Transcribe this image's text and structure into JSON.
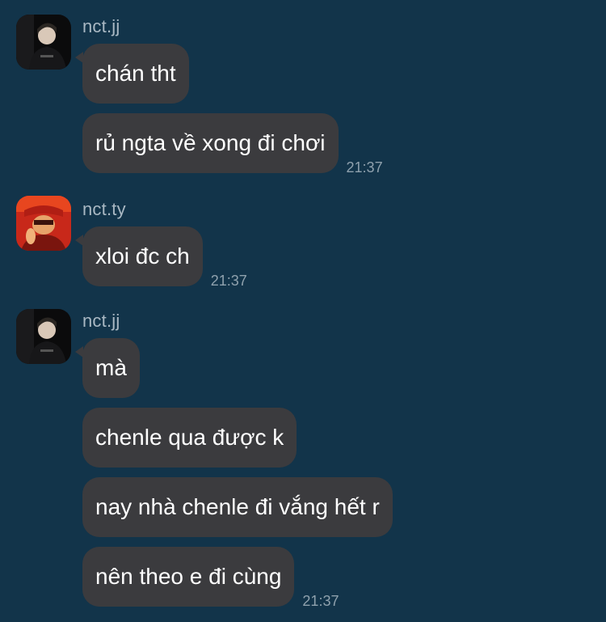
{
  "conversation": {
    "groups": [
      {
        "sender": "nct.jj",
        "avatar_icon": "profile-photo-dark",
        "messages": [
          {
            "text": "chán tht",
            "time": ""
          },
          {
            "text": "rủ ngta về xong đi chơi",
            "time": "21:37"
          }
        ]
      },
      {
        "sender": "nct.ty",
        "avatar_icon": "profile-photo-red",
        "messages": [
          {
            "text": "xloi đc ch",
            "time": "21:37"
          }
        ]
      },
      {
        "sender": "nct.jj",
        "avatar_icon": "profile-photo-dark",
        "messages": [
          {
            "text": "mà",
            "time": ""
          },
          {
            "text": "chenle qua được k",
            "time": ""
          },
          {
            "text": "nay nhà chenle đi vắng hết r",
            "time": ""
          },
          {
            "text": "nên theo e đi cùng",
            "time": "21:37"
          }
        ]
      }
    ]
  },
  "colors": {
    "background": "#12344a",
    "bubble": "#3b3b3e",
    "bubble_text": "#ffffff",
    "sender_text": "#a9b8c3",
    "time_text": "#8fa1ad"
  }
}
